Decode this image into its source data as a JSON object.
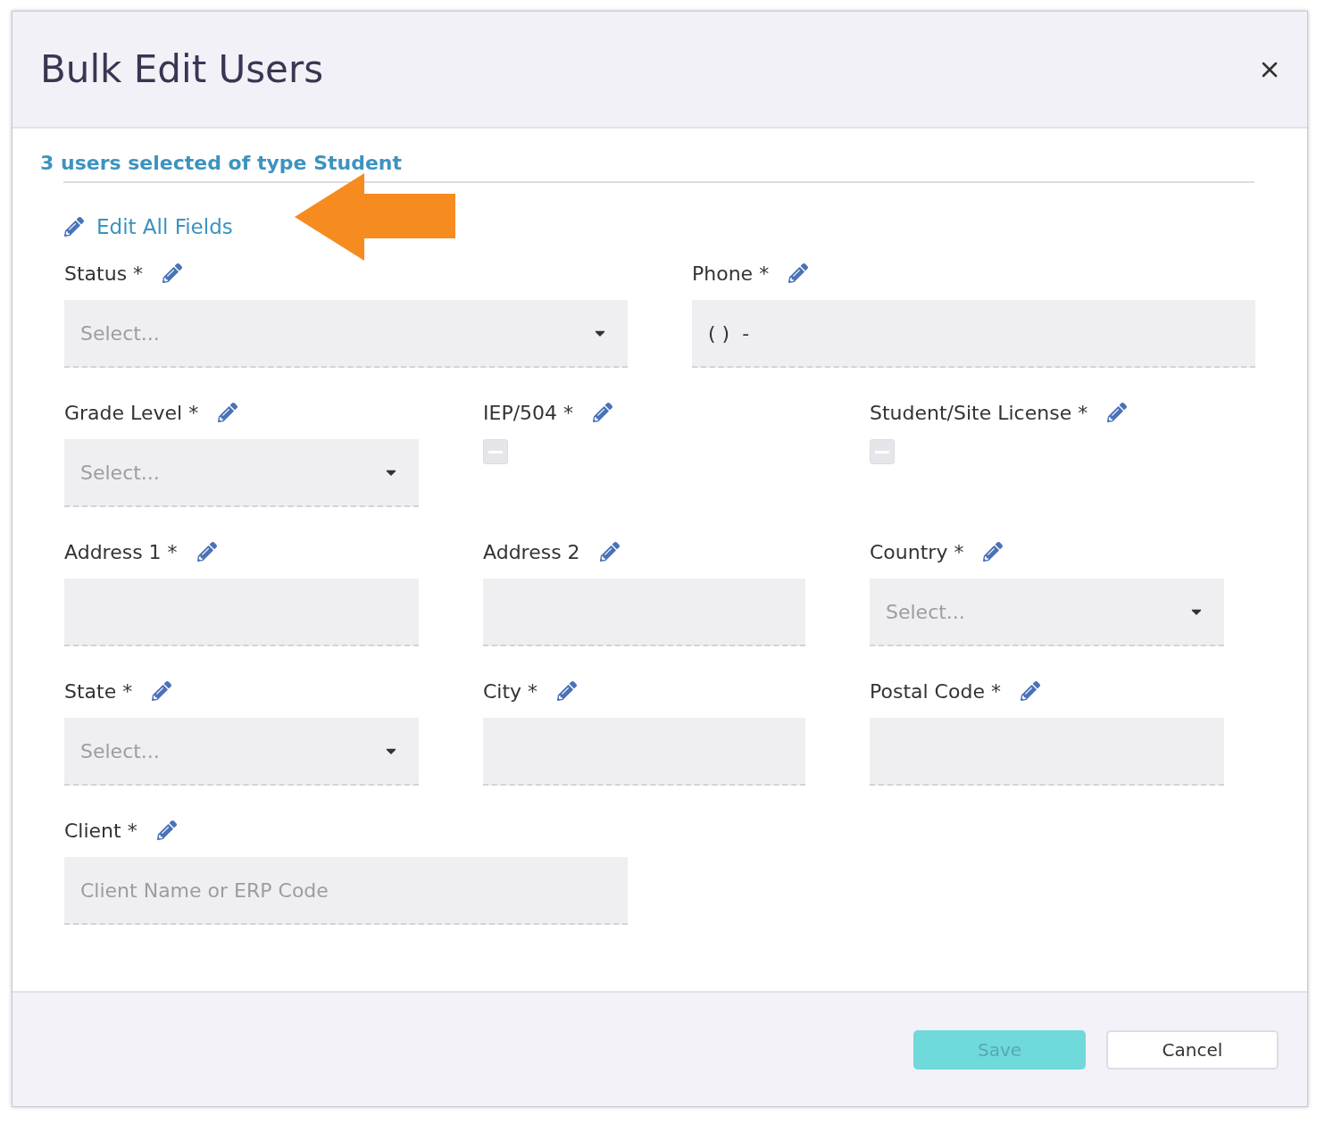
{
  "dialog": {
    "title": "Bulk Edit Users"
  },
  "summary": "3 users selected of type Student",
  "edit_all": {
    "label": "Edit All Fields"
  },
  "rows": [
    [
      {
        "label": "Status *",
        "kind": "select",
        "placeholder": "Select..."
      },
      {
        "label": "Phone *",
        "kind": "input",
        "value": "( )  -"
      }
    ],
    [
      {
        "label": "Grade Level *",
        "kind": "select",
        "placeholder": "Select..."
      },
      {
        "label": "IEP/504 *",
        "kind": "checkbox",
        "indeterminate": true
      },
      {
        "label": "Student/Site License *",
        "kind": "checkbox",
        "indeterminate": true
      }
    ],
    [
      {
        "label": "Address 1 *",
        "kind": "input"
      },
      {
        "label": "Address 2",
        "kind": "input"
      },
      {
        "label": "Country *",
        "kind": "select",
        "placeholder": "Select..."
      }
    ],
    [
      {
        "label": "State *",
        "kind": "select",
        "placeholder": "Select..."
      },
      {
        "label": "City *",
        "kind": "input"
      },
      {
        "label": "Postal Code *",
        "kind": "input"
      }
    ],
    [
      {
        "label": "Client *",
        "kind": "input",
        "placeholder": "Client Name or ERP Code"
      }
    ]
  ],
  "buttons": [
    {
      "label": "Save",
      "kind": "primary",
      "disabled": true
    },
    {
      "label": "Cancel",
      "kind": "secondary",
      "disabled": false
    }
  ]
}
